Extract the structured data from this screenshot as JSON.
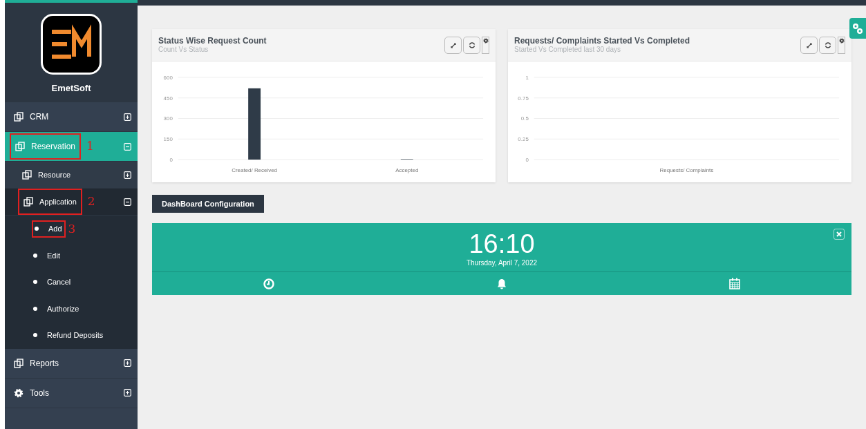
{
  "brand": {
    "name": "EmetSoft"
  },
  "sidebar": {
    "items": [
      {
        "label": "CRM",
        "kind": "module",
        "expanded": false,
        "selected": false
      },
      {
        "label": "Reservation",
        "kind": "module",
        "expanded": true,
        "selected": true,
        "annotation": "1",
        "children": [
          {
            "label": "Resource",
            "kind": "section",
            "expanded": false,
            "selected": false
          },
          {
            "label": "Application",
            "kind": "section",
            "expanded": true,
            "selected": true,
            "annotation": "2",
            "children": [
              {
                "label": "Add",
                "annotation": "3"
              },
              {
                "label": "Edit"
              },
              {
                "label": "Cancel"
              },
              {
                "label": "Authorize"
              },
              {
                "label": "Refund Deposits"
              }
            ]
          }
        ]
      },
      {
        "label": "Reports",
        "kind": "module",
        "expanded": false,
        "selected": false
      },
      {
        "label": "Tools",
        "kind": "tool",
        "expanded": false,
        "selected": false
      }
    ]
  },
  "widgets": [
    {
      "title": "Status Wise Request Count",
      "subtitle": "Count Vs Status",
      "chart_data": {
        "type": "bar",
        "categories": [
          "Created/ Received",
          "Accepted"
        ],
        "series": [
          {
            "color": "#2f3b48",
            "values": [
              520,
              3
            ]
          }
        ],
        "grid": true,
        "ylim": [
          0,
          600
        ],
        "yticks": [
          0,
          150,
          300,
          450,
          600
        ]
      }
    },
    {
      "title": "Requests/ Complaints Started Vs Completed",
      "subtitle": "Started Vs Completed last 30 days",
      "chart_data": {
        "type": "bar",
        "categories": [
          "Requests/ Complaints"
        ],
        "series": [
          {
            "values": [
              0
            ]
          }
        ],
        "grid": true,
        "ylim": [
          0,
          1
        ],
        "yticks": [
          0,
          0.25,
          0.5,
          0.75,
          1
        ]
      }
    }
  ],
  "config_button": "DashBoard Configuration",
  "clock": {
    "time": "16:10",
    "date": "Thursday, April 7, 2022"
  }
}
